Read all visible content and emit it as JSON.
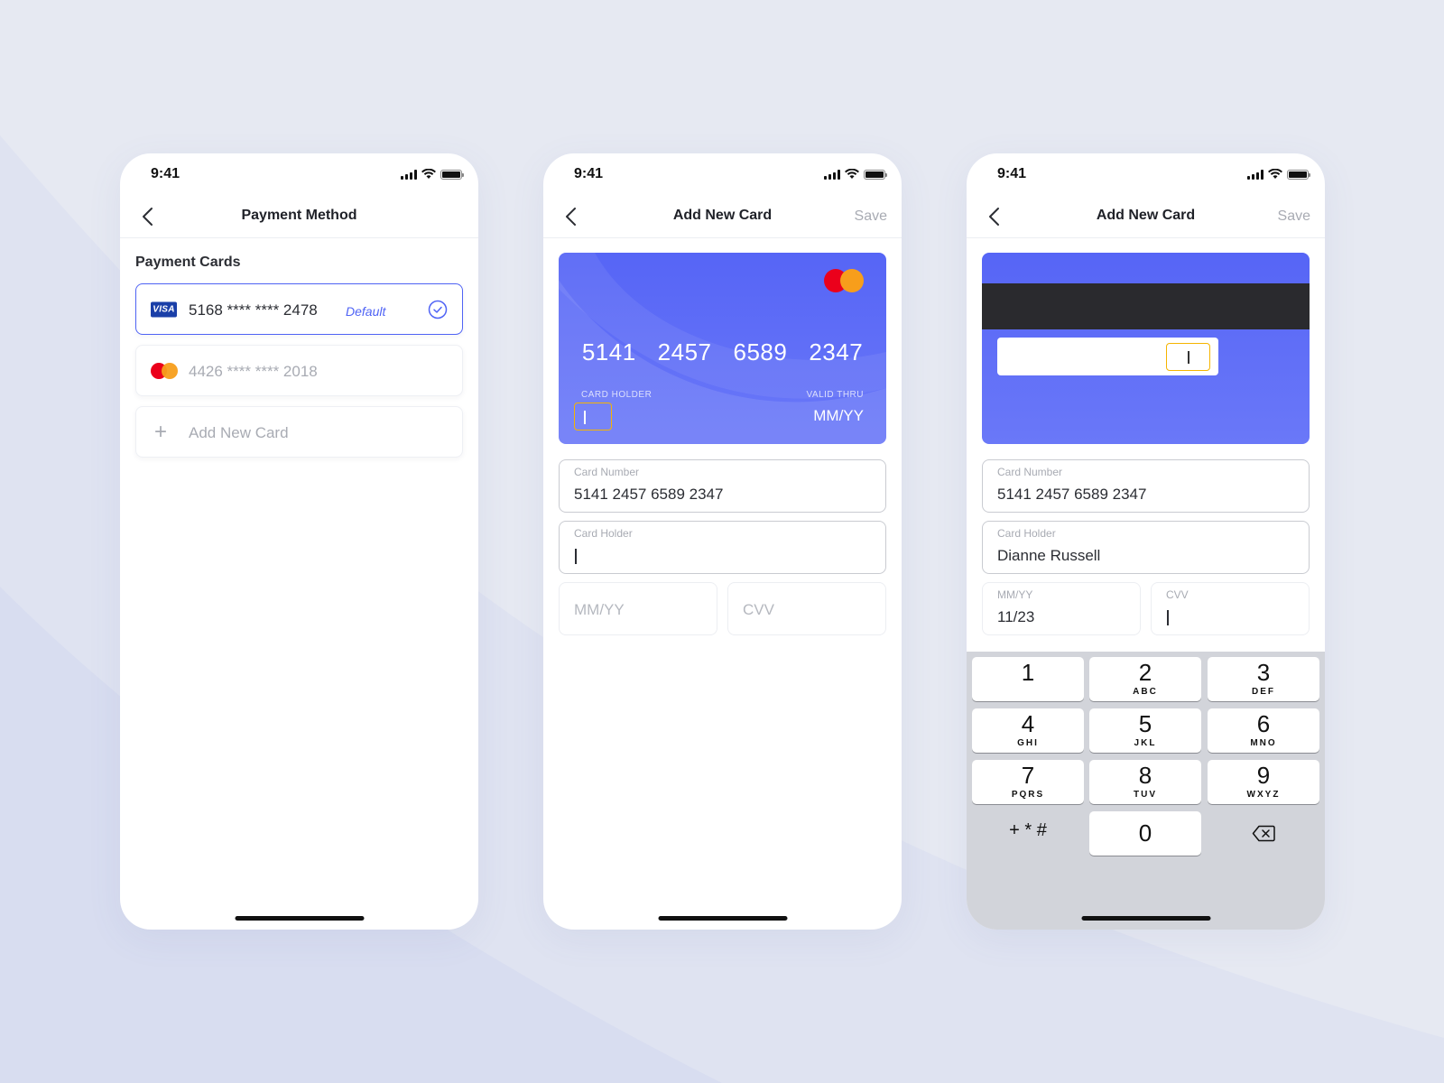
{
  "status_bar": {
    "time": "9:41"
  },
  "screens": [
    {
      "nav": {
        "title": "Payment Method"
      },
      "section_title": "Payment Cards",
      "cards": [
        {
          "brand": "visa",
          "brand_label": "VISA",
          "number": "5168 **** **** 2478",
          "badge": "Default",
          "selected": true
        },
        {
          "brand": "mastercard",
          "number": "4426 **** **** 2018",
          "selected": false
        }
      ],
      "add_card_label": "Add New Card"
    },
    {
      "nav": {
        "title": "Add New Card",
        "action": "Save"
      },
      "card_preview": {
        "digits": [
          "5141",
          "2457",
          "6589",
          "2347"
        ],
        "holder_label": "CARD HOLDER",
        "valid_label": "VALID THRU",
        "valid_value": "MM/YY"
      },
      "fields": {
        "card_number": {
          "label": "Card Number",
          "value": "5141 2457 6589 2347"
        },
        "card_holder": {
          "label": "Card Holder",
          "value": ""
        },
        "expiry": {
          "placeholder": "MM/YY"
        },
        "cvv": {
          "placeholder": "CVV"
        }
      }
    },
    {
      "nav": {
        "title": "Add New Card",
        "action": "Save"
      },
      "fields": {
        "card_number": {
          "label": "Card Number",
          "value": "5141 2457 6589 2347"
        },
        "card_holder": {
          "label": "Card Holder",
          "value": "Dianne Russell"
        },
        "expiry": {
          "label": "MM/YY",
          "value": "11/23"
        },
        "cvv": {
          "label": "CVV",
          "value": ""
        }
      },
      "keypad": {
        "keys": [
          {
            "digit": "1",
            "letters": ""
          },
          {
            "digit": "2",
            "letters": "ABC"
          },
          {
            "digit": "3",
            "letters": "DEF"
          },
          {
            "digit": "4",
            "letters": "GHI"
          },
          {
            "digit": "5",
            "letters": "JKL"
          },
          {
            "digit": "6",
            "letters": "MNO"
          },
          {
            "digit": "7",
            "letters": "PQRS"
          },
          {
            "digit": "8",
            "letters": "TUV"
          },
          {
            "digit": "9",
            "letters": "WXYZ"
          }
        ],
        "symbols": "+ * #",
        "zero": "0"
      }
    }
  ],
  "colors": {
    "accent": "#4f63f5",
    "card_bg": "#5b69f7",
    "highlight": "#f5b400",
    "background": "#e6e9f2"
  }
}
